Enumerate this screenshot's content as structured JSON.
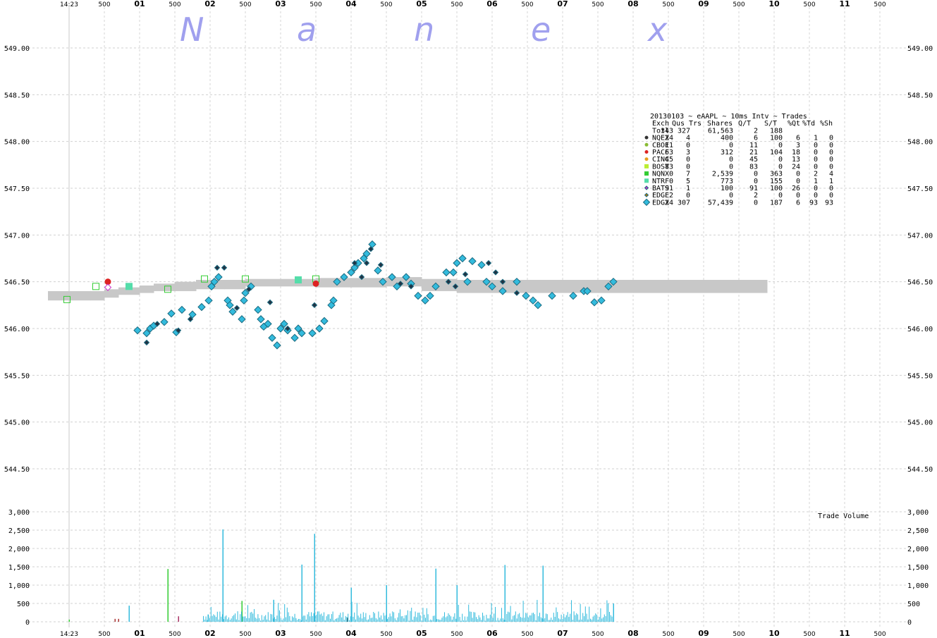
{
  "watermark": [
    "N",
    "a",
    "n",
    "e",
    "x"
  ],
  "chart_data": {
    "type": "scatter",
    "title": "20130103 ~ eAAPL ~ 10ms Intv ~ Trades",
    "time_axis": {
      "start_label": "14:23",
      "major_labels": [
        "01",
        "02",
        "03",
        "04",
        "05",
        "06",
        "07",
        "08",
        "09",
        "10",
        "11"
      ],
      "minor_label": "500"
    },
    "price_axis": {
      "ylim": [
        544.3,
        549.25
      ],
      "ticks": [
        "549.00",
        "548.50",
        "548.00",
        "547.50",
        "547.00",
        "546.50",
        "546.00",
        "545.50",
        "545.00",
        "544.50"
      ],
      "grid": true
    },
    "volume_axis": {
      "label": "Trade Volume",
      "ylim": [
        0,
        3000
      ],
      "ticks": [
        "3,000",
        "2,500",
        "2,000",
        "1,500",
        "1,000",
        "500",
        "0"
      ]
    },
    "legend": {
      "title": "20130103 ~ eAAPL ~ 10ms Intv ~ Trades",
      "columns": [
        "Exch",
        "Qus",
        "Trs",
        "Shares",
        "Q/T",
        "S/T",
        "%Qt",
        "%Td",
        "%Sh"
      ],
      "total": [
        "Totl",
        "343",
        "327",
        "61,563",
        "2",
        "188",
        "",
        "",
        ""
      ],
      "rows": [
        {
          "name": "NQEX",
          "marker": "circle",
          "color": "#333333",
          "cells": [
            "24",
            "4",
            "400",
            "6",
            "100",
            "6",
            "1",
            "0"
          ]
        },
        {
          "name": "CBOE",
          "marker": "circle",
          "color": "#88bb33",
          "cells": [
            "11",
            "0",
            "0",
            "11",
            "0",
            "3",
            "0",
            "0"
          ]
        },
        {
          "name": "PACF",
          "marker": "circle",
          "color": "#dd2222",
          "cells": [
            "63",
            "3",
            "312",
            "21",
            "104",
            "18",
            "0",
            "0"
          ]
        },
        {
          "name": "CINC",
          "marker": "circle",
          "color": "#e6a020",
          "cells": [
            "45",
            "0",
            "0",
            "45",
            "0",
            "13",
            "0",
            "0"
          ]
        },
        {
          "name": "BOST",
          "marker": "square",
          "color": "#bbee33",
          "cells": [
            "83",
            "0",
            "0",
            "83",
            "0",
            "24",
            "0",
            "0"
          ]
        },
        {
          "name": "NQNX",
          "marker": "square",
          "color": "#33cc33",
          "cells": [
            "0",
            "7",
            "2,539",
            "0",
            "363",
            "0",
            "2",
            "4"
          ]
        },
        {
          "name": "NTRF",
          "marker": "square",
          "color": "#55ddaa",
          "cells": [
            "0",
            "5",
            "773",
            "0",
            "155",
            "0",
            "1",
            "1"
          ]
        },
        {
          "name": "BATS",
          "marker": "diamond",
          "color": "#cc33cc",
          "cells": [
            "91",
            "1",
            "100",
            "91",
            "100",
            "26",
            "0",
            "0"
          ]
        },
        {
          "name": "EDGE",
          "marker": "diamond",
          "color": "#aa7711",
          "cells": [
            "2",
            "0",
            "0",
            "2",
            "0",
            "0",
            "0",
            "0"
          ]
        },
        {
          "name": "EDGX",
          "marker": "diamond",
          "color": "#33bbdd",
          "cells": [
            "24",
            "307",
            "57,439",
            "0",
            "187",
            "6",
            "93",
            "93"
          ]
        }
      ]
    },
    "nbbo_band": [
      [
        -0.3,
        546.3,
        546.4
      ],
      [
        0.3,
        546.3,
        546.4
      ],
      [
        0.5,
        546.33,
        546.42
      ],
      [
        0.7,
        546.36,
        546.44
      ],
      [
        1.0,
        546.38,
        546.46
      ],
      [
        1.2,
        546.4,
        546.48
      ],
      [
        1.5,
        546.4,
        546.5
      ],
      [
        1.8,
        546.42,
        546.52
      ],
      [
        2.2,
        546.42,
        546.52
      ],
      [
        2.5,
        546.45,
        546.53
      ],
      [
        3.0,
        546.45,
        546.53
      ],
      [
        3.5,
        546.44,
        546.54
      ],
      [
        4.0,
        546.44,
        546.54
      ],
      [
        4.5,
        546.45,
        546.55
      ],
      [
        5.0,
        546.4,
        546.53
      ],
      [
        5.5,
        546.38,
        546.52
      ],
      [
        6.0,
        546.38,
        546.52
      ],
      [
        6.5,
        546.38,
        546.52
      ],
      [
        7.0,
        546.38,
        546.52
      ],
      [
        7.5,
        546.38,
        546.52
      ],
      [
        8.0,
        546.38,
        546.52
      ],
      [
        8.5,
        546.38,
        546.52
      ],
      [
        9.0,
        546.38,
        546.52
      ],
      [
        9.5,
        546.38,
        546.52
      ],
      [
        9.9,
        546.38,
        546.52
      ]
    ],
    "series": [
      {
        "name": "EDGX",
        "marker": "diamond",
        "color": "#33bbdd",
        "points": [
          [
            0.97,
            545.98
          ],
          [
            1.1,
            545.95
          ],
          [
            1.15,
            546.0
          ],
          [
            1.2,
            546.03
          ],
          [
            1.35,
            546.07
          ],
          [
            1.45,
            546.16
          ],
          [
            1.52,
            545.96
          ],
          [
            1.6,
            546.2
          ],
          [
            1.75,
            546.15
          ],
          [
            1.88,
            546.23
          ],
          [
            1.98,
            546.3
          ],
          [
            2.02,
            546.45
          ],
          [
            2.06,
            546.5
          ],
          [
            2.12,
            546.55
          ],
          [
            2.25,
            546.3
          ],
          [
            2.28,
            546.25
          ],
          [
            2.32,
            546.18
          ],
          [
            2.45,
            546.1
          ],
          [
            2.48,
            546.3
          ],
          [
            2.5,
            546.38
          ],
          [
            2.58,
            546.45
          ],
          [
            2.68,
            546.2
          ],
          [
            2.72,
            546.1
          ],
          [
            2.76,
            546.02
          ],
          [
            2.82,
            546.05
          ],
          [
            2.88,
            545.9
          ],
          [
            2.95,
            545.82
          ],
          [
            3.0,
            546.0
          ],
          [
            3.05,
            546.05
          ],
          [
            3.1,
            545.98
          ],
          [
            3.2,
            545.9
          ],
          [
            3.25,
            546.0
          ],
          [
            3.3,
            545.95
          ],
          [
            3.45,
            545.95
          ],
          [
            3.55,
            546.0
          ],
          [
            3.62,
            546.08
          ],
          [
            3.72,
            546.25
          ],
          [
            3.75,
            546.3
          ],
          [
            3.8,
            546.5
          ],
          [
            3.9,
            546.55
          ],
          [
            4.0,
            546.6
          ],
          [
            4.05,
            546.65
          ],
          [
            4.1,
            546.7
          ],
          [
            4.18,
            546.75
          ],
          [
            4.22,
            546.8
          ],
          [
            4.3,
            546.9
          ],
          [
            4.38,
            546.62
          ],
          [
            4.45,
            546.5
          ],
          [
            4.58,
            546.55
          ],
          [
            4.65,
            546.45
          ],
          [
            4.78,
            546.55
          ],
          [
            4.85,
            546.48
          ],
          [
            4.95,
            546.35
          ],
          [
            5.05,
            546.3
          ],
          [
            5.12,
            546.35
          ],
          [
            5.2,
            546.45
          ],
          [
            5.35,
            546.6
          ],
          [
            5.45,
            546.6
          ],
          [
            5.5,
            546.7
          ],
          [
            5.58,
            546.75
          ],
          [
            5.65,
            546.5
          ],
          [
            5.72,
            546.72
          ],
          [
            5.85,
            546.68
          ],
          [
            5.92,
            546.5
          ],
          [
            6.0,
            546.45
          ],
          [
            6.15,
            546.4
          ],
          [
            6.35,
            546.5
          ],
          [
            6.48,
            546.35
          ],
          [
            6.58,
            546.3
          ],
          [
            6.65,
            546.25
          ],
          [
            6.85,
            546.35
          ],
          [
            7.15,
            546.35
          ],
          [
            7.3,
            546.4
          ],
          [
            7.35,
            546.4
          ],
          [
            7.45,
            546.28
          ],
          [
            7.55,
            546.3
          ],
          [
            7.65,
            546.45
          ],
          [
            7.72,
            546.5
          ]
        ]
      },
      {
        "name": "NQEX",
        "marker": "diamond",
        "color": "#223344",
        "points": [
          [
            1.1,
            545.85
          ],
          [
            1.25,
            546.05
          ],
          [
            1.55,
            545.98
          ],
          [
            1.72,
            546.1
          ],
          [
            2.1,
            546.65
          ],
          [
            2.2,
            546.65
          ],
          [
            2.38,
            546.22
          ],
          [
            2.55,
            546.42
          ],
          [
            2.85,
            546.28
          ],
          [
            3.1,
            546.0
          ],
          [
            3.48,
            546.25
          ],
          [
            4.05,
            546.7
          ],
          [
            4.15,
            546.55
          ],
          [
            4.22,
            546.7
          ],
          [
            4.28,
            546.85
          ],
          [
            4.42,
            546.68
          ],
          [
            4.7,
            546.48
          ],
          [
            4.85,
            546.45
          ],
          [
            5.38,
            546.5
          ],
          [
            5.48,
            546.45
          ],
          [
            5.62,
            546.58
          ],
          [
            5.95,
            546.7
          ],
          [
            6.05,
            546.6
          ],
          [
            6.15,
            546.5
          ],
          [
            6.35,
            546.38
          ]
        ]
      },
      {
        "name": "NQNX",
        "marker": "square-open",
        "color": "#33cc33",
        "points": [
          [
            -0.03,
            546.31
          ],
          [
            1.92,
            546.53
          ],
          [
            2.5,
            546.53
          ],
          [
            3.5,
            546.53
          ],
          [
            1.4,
            546.42
          ],
          [
            0.38,
            546.45
          ]
        ]
      },
      {
        "name": "NTRF",
        "marker": "square",
        "color": "#55ddaa",
        "points": [
          [
            0.85,
            546.45
          ],
          [
            3.25,
            546.52
          ]
        ]
      },
      {
        "name": "PACF",
        "marker": "circle",
        "color": "#dd2222",
        "points": [
          [
            0.55,
            546.5
          ],
          [
            3.5,
            546.48
          ]
        ]
      },
      {
        "name": "BATS",
        "marker": "diamond-open",
        "color": "#cc33cc",
        "points": [
          [
            0.55,
            546.44
          ]
        ]
      }
    ],
    "volume_bars": [
      {
        "t": 0.0,
        "v": 60,
        "color": "#33cc33"
      },
      {
        "t": 0.65,
        "v": 80,
        "color": "#aa3333"
      },
      {
        "t": 0.7,
        "v": 80,
        "color": "#aa3333"
      },
      {
        "t": 0.85,
        "v": 440,
        "color": "#33bbdd"
      },
      {
        "t": 1.4,
        "v": 1440,
        "color": "#33cc33"
      },
      {
        "t": 1.55,
        "v": 150,
        "color": "#aa3366"
      },
      {
        "t": 1.97,
        "v": 200,
        "color": "#33bbdd"
      },
      {
        "t": 2.18,
        "v": 2520,
        "color": "#33bbdd"
      },
      {
        "t": 2.45,
        "v": 570,
        "color": "#33cc33"
      },
      {
        "t": 2.9,
        "v": 600,
        "color": "#33bbdd"
      },
      {
        "t": 3.3,
        "v": 1560,
        "color": "#33bbdd"
      },
      {
        "t": 3.48,
        "v": 2400,
        "color": "#33bbdd"
      },
      {
        "t": 3.95,
        "v": 110,
        "color": "#222222"
      },
      {
        "t": 4.0,
        "v": 930,
        "color": "#33bbdd"
      },
      {
        "t": 4.5,
        "v": 1000,
        "color": "#33bbdd"
      },
      {
        "t": 5.2,
        "v": 1450,
        "color": "#33bbdd"
      },
      {
        "t": 5.5,
        "v": 1000,
        "color": "#33bbdd"
      },
      {
        "t": 6.18,
        "v": 1550,
        "color": "#33bbdd"
      },
      {
        "t": 6.72,
        "v": 1530,
        "color": "#33bbdd"
      },
      {
        "t": 7.72,
        "v": 500,
        "color": "#33bbdd"
      }
    ]
  }
}
